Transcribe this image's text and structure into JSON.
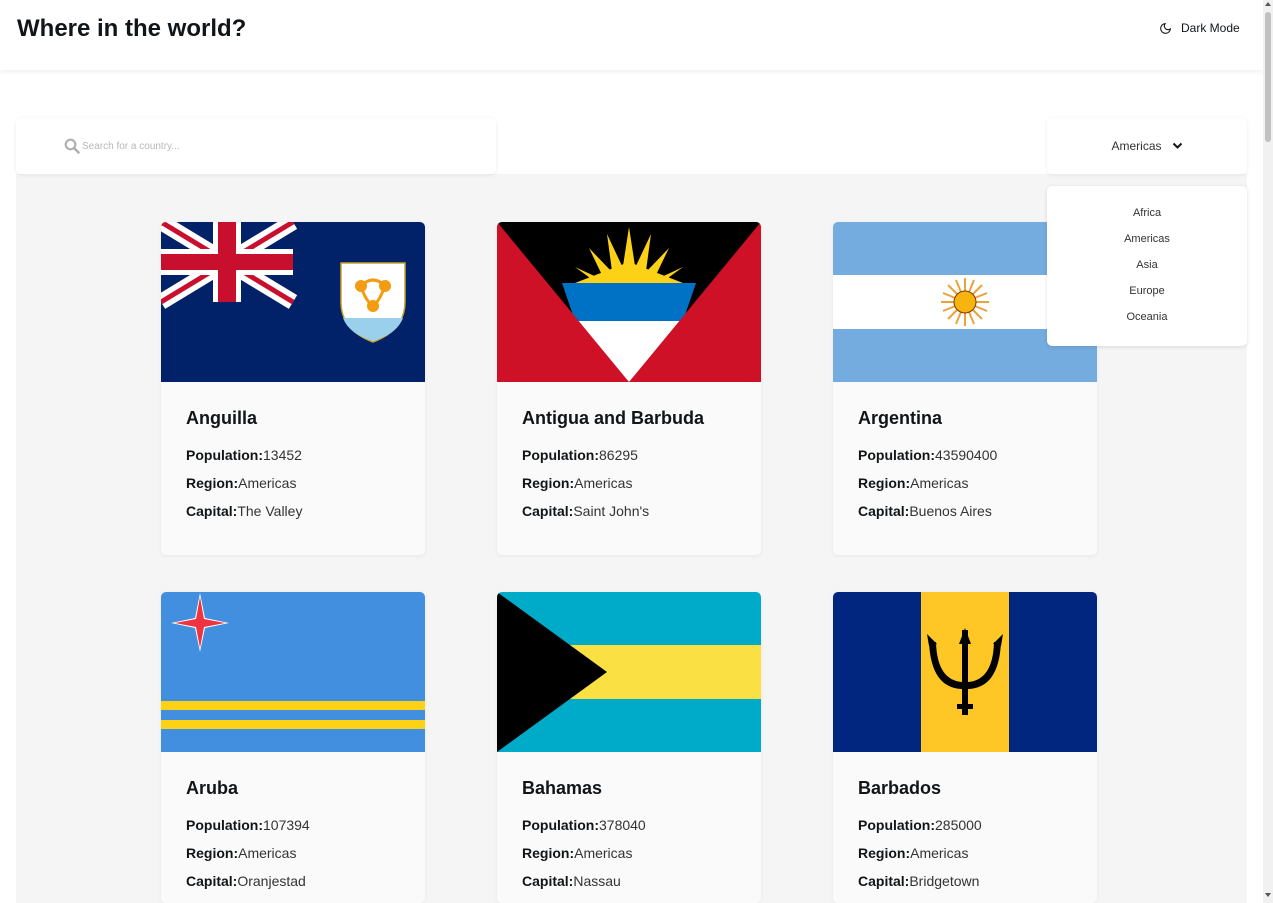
{
  "header": {
    "title": "Where in the world?",
    "dark_mode_label": "Dark Mode",
    "dark_mode_icon": "moon-icon"
  },
  "search": {
    "placeholder": "Search for a country...",
    "value": "",
    "icon": "search-icon"
  },
  "filter": {
    "selected": "Americas",
    "icon": "chevron-down-icon",
    "options": [
      "Africa",
      "Americas",
      "Asia",
      "Europe",
      "Oceania"
    ]
  },
  "labels": {
    "population": "Population:",
    "region": "Region:",
    "capital": "Capital:"
  },
  "countries": [
    {
      "name": "Anguilla",
      "population": "13452",
      "region": "Americas",
      "capital": "The Valley",
      "flag": "anguilla-flag"
    },
    {
      "name": "Antigua and Barbuda",
      "population": "86295",
      "region": "Americas",
      "capital": "Saint John's",
      "flag": "antigua-and-barbuda-flag"
    },
    {
      "name": "Argentina",
      "population": "43590400",
      "region": "Americas",
      "capital": "Buenos Aires",
      "flag": "argentina-flag"
    },
    {
      "name": "Aruba",
      "population": "107394",
      "region": "Americas",
      "capital": "Oranjestad",
      "flag": "aruba-flag"
    },
    {
      "name": "Bahamas",
      "population": "378040",
      "region": "Americas",
      "capital": "Nassau",
      "flag": "bahamas-flag"
    },
    {
      "name": "Barbados",
      "population": "285000",
      "region": "Americas",
      "capital": "Bridgetown",
      "flag": "barbados-flag"
    }
  ],
  "colors": {
    "background": "#f5f5f5",
    "card": "#fafafa",
    "text": "#111517"
  }
}
